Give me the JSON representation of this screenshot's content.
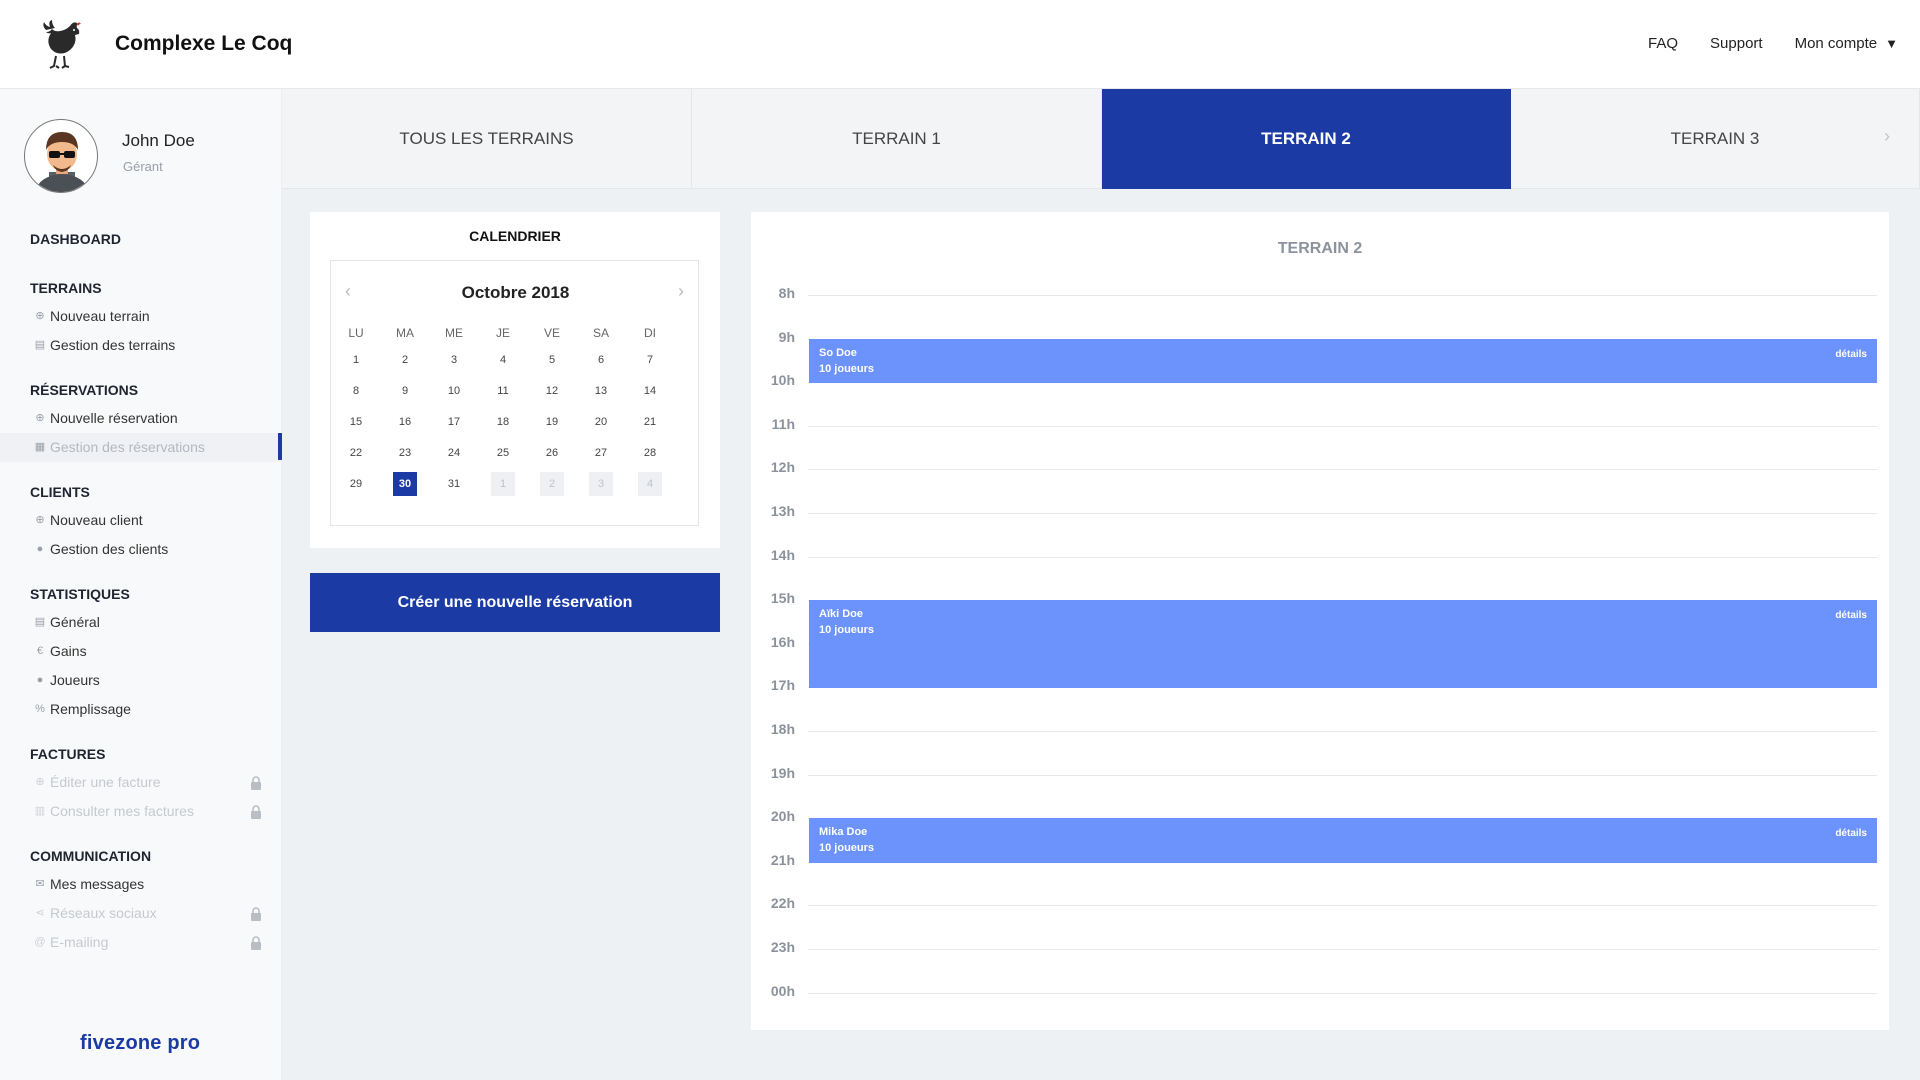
{
  "header": {
    "brand": "Complexe Le Coq",
    "nav": {
      "faq": "FAQ",
      "support": "Support",
      "account": "Mon compte",
      "account_caret": "▼"
    }
  },
  "user": {
    "name": "John Doe",
    "role": "Gérant"
  },
  "sidebar": {
    "dashboard": "DASHBOARD",
    "terrains": {
      "title": "TERRAINS",
      "new": "Nouveau terrain",
      "manage": "Gestion des terrains"
    },
    "reservations": {
      "title": "RÉSERVATIONS",
      "new": "Nouvelle réservation",
      "manage": "Gestion des réservations"
    },
    "clients": {
      "title": "CLIENTS",
      "new": "Nouveau client",
      "manage": "Gestion des clients"
    },
    "stats": {
      "title": "STATISTIQUES",
      "general": "Général",
      "gains": "Gains",
      "players": "Joueurs",
      "fill": "Remplissage"
    },
    "invoices": {
      "title": "FACTURES",
      "edit": "Éditer une facture",
      "view": "Consulter mes factures"
    },
    "communication": {
      "title": "COMMUNICATION",
      "messages": "Mes messages",
      "social": "Réseaux sociaux",
      "email": "E-mailing"
    },
    "footer_brand": "fivezone pro"
  },
  "tabs": [
    "TOUS LES TERRAINS",
    "TERRAIN 1",
    "TERRAIN 2",
    "TERRAIN 3"
  ],
  "active_tab": 2,
  "calendar": {
    "title": "CALENDRIER",
    "month": "Octobre 2018",
    "weekdays": [
      "LU",
      "MA",
      "ME",
      "JE",
      "VE",
      "SA",
      "DI"
    ],
    "weeks": [
      [
        "1",
        "2",
        "3",
        "4",
        "5",
        "6",
        "7"
      ],
      [
        "8",
        "9",
        "10",
        "11",
        "12",
        "13",
        "14"
      ],
      [
        "15",
        "16",
        "17",
        "18",
        "19",
        "20",
        "21"
      ],
      [
        "22",
        "23",
        "24",
        "25",
        "26",
        "27",
        "28"
      ],
      [
        "29",
        "30",
        "31",
        "1",
        "2",
        "3",
        "4"
      ]
    ],
    "selected_day": "30"
  },
  "create_button": "Créer une nouvelle réservation",
  "schedule": {
    "title": "TERRAIN 2",
    "hours": [
      "8h",
      "9h",
      "10h",
      "11h",
      "12h",
      "13h",
      "14h",
      "15h",
      "16h",
      "17h",
      "18h",
      "19h",
      "20h",
      "21h",
      "22h",
      "23h",
      "00h"
    ],
    "events": [
      {
        "name": "So Doe",
        "players": "10 joueurs",
        "details": "détails",
        "start": "9h",
        "end": "10h"
      },
      {
        "name": "Aïki Doe",
        "players": "10 joueurs",
        "details": "détails",
        "start": "15h",
        "end": "17h"
      },
      {
        "name": "Mika Doe",
        "players": "10 joueurs",
        "details": "détails",
        "start": "20h",
        "end": "21h"
      }
    ]
  }
}
